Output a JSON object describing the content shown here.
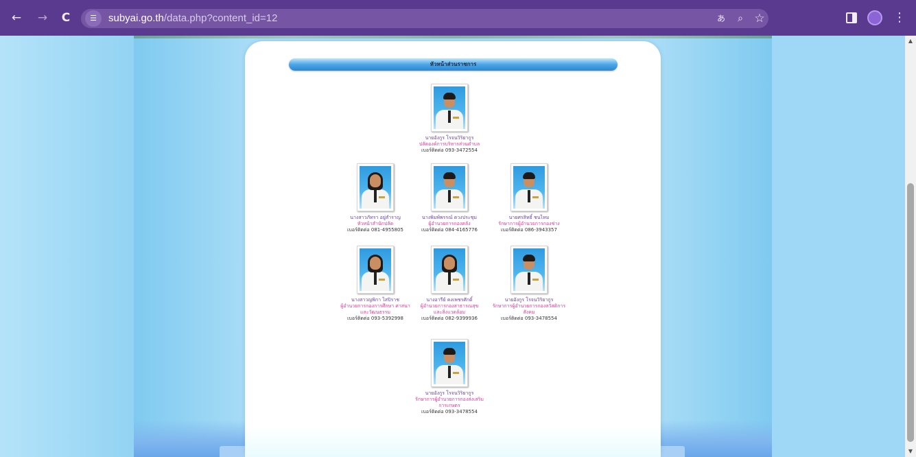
{
  "browser": {
    "url_host": "subyai.go.th",
    "url_path": "/data.php?content_id=12",
    "icons": [
      "back-arrow-icon",
      "forward-arrow-icon",
      "reload-icon",
      "site-settings-icon",
      "translate-icon",
      "zoom-icon",
      "star-bookmark-icon",
      "side-panel-icon",
      "profile-avatar-icon",
      "more-menu-icon"
    ]
  },
  "page": {
    "section_title": "หัวหน้าส่วนราชการ",
    "staff": [
      {
        "name": "นายอังกูร โรจนวิริยากูร",
        "role": [
          "ปลัดองค์การบริหารส่วนตำบล"
        ],
        "phone": "เบอร์ติดต่อ 093-3472554",
        "hair": "short"
      },
      {
        "name": "นางสาวภัทรา อยู่สำราญ",
        "role": [
          "หัวหน้าสำนักปลัด"
        ],
        "phone": "เบอร์ติดต่อ 081-4955805",
        "hair": "long"
      },
      {
        "name": "นางพิมพ์พรรณ์ ดวงประชุม",
        "role": [
          "ผู้อำนวยการกองคลัง"
        ],
        "phone": "เบอร์ติดต่อ 084-4165776",
        "hair": "short"
      },
      {
        "name": "นายศรสิทธิ์ ชนไหม",
        "role": [
          "รักษาการผู้อำนวยการกองช่าง"
        ],
        "phone": "เบอร์ติดต่อ 086-3943357",
        "hair": "short"
      },
      {
        "name": "นางสาวญพิกา ไสปิราช",
        "role": [
          "ผู้อำนวยการกองการศึกษา ศาสนา",
          "และวัฒนธรรม"
        ],
        "phone": "เบอร์ติดต่อ 093-5392998",
        "hair": "long"
      },
      {
        "name": "นางอารีย์ คงเพชรศักดิ์",
        "role": [
          "ผู้อำนวยการกองสาธารณสุข",
          "และสิ่งแวดล้อม"
        ],
        "phone": "เบอร์ติดต่อ 082-9399936",
        "hair": "long"
      },
      {
        "name": "นายอังกูร โรจนวิริยากูร",
        "role": [
          "รักษาการผู้อำนวยการกองสวัสดิการ",
          "สังคม"
        ],
        "phone": "เบอร์ติดต่อ 093-3478554",
        "hair": "short"
      },
      {
        "name": "นายอังกูร โรจนวิริยากูร",
        "role": [
          "รักษาการผู้อำนวยการกองส่งเสริม",
          "การเกษตร"
        ],
        "phone": "เบอร์ติดต่อ 093-3478554",
        "hair": "short"
      }
    ]
  },
  "colors": {
    "browser_frame": "#5a3a8e",
    "page_background": "#9fd8f6",
    "name_text": "#6a3fb3",
    "role_text": "#e0399a"
  }
}
